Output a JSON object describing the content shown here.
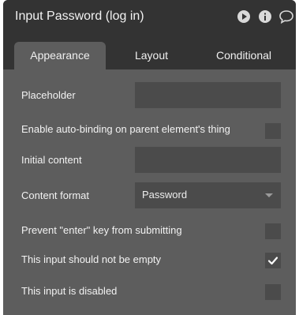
{
  "window": {
    "title": "Input Password (log in)",
    "icons": [
      "play-icon",
      "info-icon",
      "comment-icon"
    ]
  },
  "tabs": [
    {
      "label": "Appearance",
      "active": true
    },
    {
      "label": "Layout",
      "active": false
    },
    {
      "label": "Conditional",
      "active": false
    }
  ],
  "fields": {
    "placeholder": {
      "label": "Placeholder",
      "value": ""
    },
    "auto_binding": {
      "label": "Enable auto-binding on parent element's thing",
      "checked": false
    },
    "initial_content": {
      "label": "Initial content",
      "value": ""
    },
    "content_format": {
      "label": "Content format",
      "value": "Password"
    },
    "prevent_enter": {
      "label": "Prevent \"enter\" key from submitting",
      "checked": false
    },
    "not_empty": {
      "label": "This input should not be empty",
      "checked": true
    },
    "disabled": {
      "label": "This input is disabled",
      "checked": false
    }
  },
  "colors": {
    "header_bg": "#333333",
    "panel_bg": "#5d5d5d",
    "input_bg": "#4b4b4b",
    "text": "#f2f2f2"
  }
}
